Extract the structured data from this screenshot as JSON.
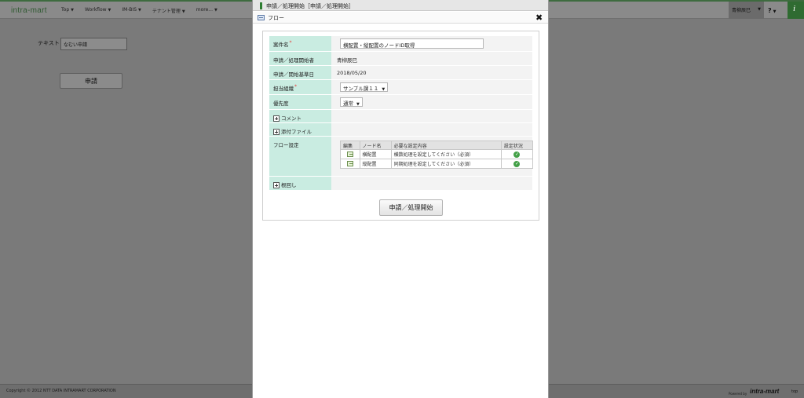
{
  "app": {
    "logo": "intra-mart",
    "nav": [
      "Top",
      "Workflow",
      "IM-BIS",
      "テナント管理",
      "more..."
    ],
    "user_name": "青柳辰巳",
    "help": "?",
    "corner_icon": "i"
  },
  "background": {
    "text_label": "テキスト",
    "text_value": "なむい申請",
    "apply_button": "申請"
  },
  "footer": {
    "copyright": "Copyright © 2012 NTT DATA INTRAMART CORPORATION",
    "powered_by": "Powered by",
    "powered_logo": "intra-mart",
    "top_link": "top"
  },
  "dialog": {
    "title": "申請／処理開始［申請／処理開始］",
    "subtitle": "フロー",
    "form": {
      "matter_name_label": "案件名",
      "matter_name_value": "横配置・縦配置のノードID取得",
      "applicant_label": "申請／処理開始者",
      "applicant_value": "青柳辰巳",
      "base_date_label": "申請／開始基準日",
      "base_date_value": "2018/05/20",
      "org_label": "担当組織",
      "org_value": "サンプル課１１",
      "priority_label": "優先度",
      "priority_value": "通常",
      "comment_label": "コメント",
      "attachment_label": "添付ファイル",
      "flow_setting_label": "フロー設定",
      "pullback_label": "根回し",
      "flow_table": {
        "headers": [
          "編集",
          "ノード名",
          "必要な設定内容",
          "設定状況"
        ],
        "rows": [
          {
            "node": "横配置",
            "content": "横数処理を設定してください（必須）"
          },
          {
            "node": "縦配置",
            "content": "同期処理を設定してください（必須）"
          }
        ]
      },
      "submit_button": "申請／処理開始"
    }
  },
  "colors": {
    "label_bg": "#c9ece1",
    "accent": "#2e7d32",
    "required": "#e53935"
  }
}
